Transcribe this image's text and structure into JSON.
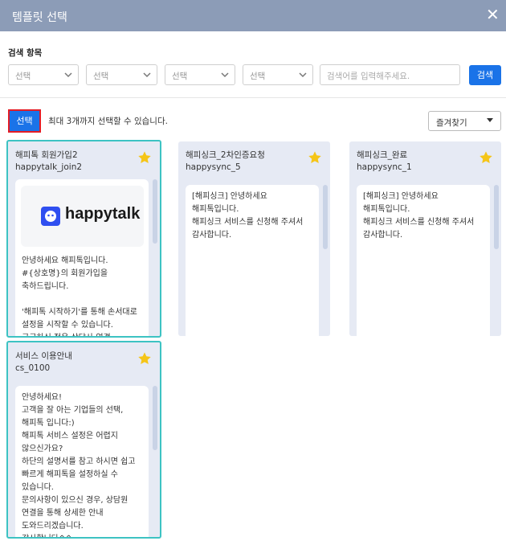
{
  "window": {
    "title": "템플릿 선택"
  },
  "search": {
    "label": "검색 항목",
    "selects": [
      "선택",
      "선택",
      "선택",
      "선택"
    ],
    "input_placeholder": "검색어를 입력해주세요.",
    "button_label": "검색"
  },
  "toolbar": {
    "select_button": "선택",
    "hint": "최대 3개까지 선택할 수 있습니다.",
    "favorites_dropdown": "즐겨찾기"
  },
  "templates": [
    {
      "name": "해피톡 회원가입2",
      "code": "happytalk_join2",
      "logo_text": "happytalk",
      "body": "안녕하세요 해피톡입니다.\n#{상호명}의 회원가입을\n축하드립니다.\n\n'해피톡 시작하기'를 통해 손서대로\n설정을 시작할 수 있습니다.\n궁금하신 점은 상담사 연결"
    },
    {
      "name": "해피싱크_2차인증요청",
      "code": "happysync_5",
      "body": "[해피싱크] 안녕하세요\n해피톡입니다.\n해피싱크 서비스를 신청해 주셔서\n감사합니다."
    },
    {
      "name": "해피싱크_완료",
      "code": "happysync_1",
      "body": "[해피싱크] 안녕하세요\n해피톡입니다.\n해피싱크 서비스를 신청해 주셔서\n감사합니다."
    },
    {
      "name": "서비스 이용안내",
      "code": "cs_0100",
      "body": "안녕하세요!\n고객을 잘 아는 기업들의 선택,\n해피톡 입니다:)\n해피톡 서비스 설정은 어렵지\n않으신가요?\n하단의 설명서를 참고 하시면 쉽고\n빠르게 해피톡을 설정하실 수\n있습니다.\n문의사항이 있으신 경우, 상담원\n연결을 통해 상세한 안내\n도와드리겠습니다.\n감사합니다^^"
    }
  ],
  "colors": {
    "titlebar": "#8c9cb7",
    "primary": "#1a73e8",
    "selected_border": "#3dc3c3",
    "star": "#f5c518",
    "card_bg": "#e6eaf4"
  }
}
